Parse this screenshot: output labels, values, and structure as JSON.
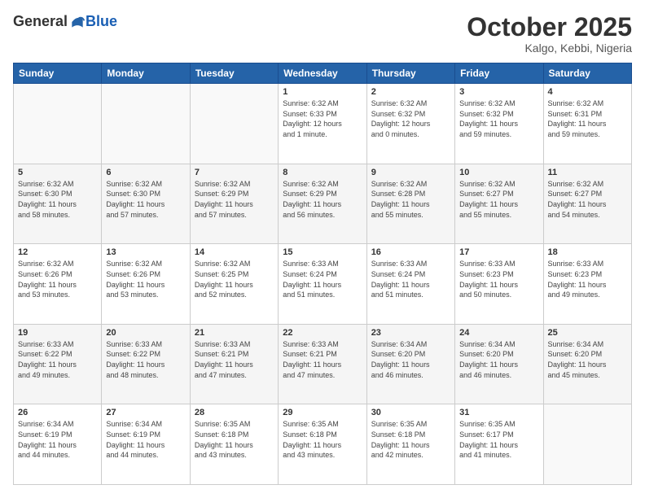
{
  "logo": {
    "general": "General",
    "blue": "Blue"
  },
  "header": {
    "month": "October 2025",
    "location": "Kalgo, Kebbi, Nigeria"
  },
  "weekdays": [
    "Sunday",
    "Monday",
    "Tuesday",
    "Wednesday",
    "Thursday",
    "Friday",
    "Saturday"
  ],
  "weeks": [
    [
      {
        "day": "",
        "info": ""
      },
      {
        "day": "",
        "info": ""
      },
      {
        "day": "",
        "info": ""
      },
      {
        "day": "1",
        "info": "Sunrise: 6:32 AM\nSunset: 6:33 PM\nDaylight: 12 hours\nand 1 minute."
      },
      {
        "day": "2",
        "info": "Sunrise: 6:32 AM\nSunset: 6:32 PM\nDaylight: 12 hours\nand 0 minutes."
      },
      {
        "day": "3",
        "info": "Sunrise: 6:32 AM\nSunset: 6:32 PM\nDaylight: 11 hours\nand 59 minutes."
      },
      {
        "day": "4",
        "info": "Sunrise: 6:32 AM\nSunset: 6:31 PM\nDaylight: 11 hours\nand 59 minutes."
      }
    ],
    [
      {
        "day": "5",
        "info": "Sunrise: 6:32 AM\nSunset: 6:30 PM\nDaylight: 11 hours\nand 58 minutes."
      },
      {
        "day": "6",
        "info": "Sunrise: 6:32 AM\nSunset: 6:30 PM\nDaylight: 11 hours\nand 57 minutes."
      },
      {
        "day": "7",
        "info": "Sunrise: 6:32 AM\nSunset: 6:29 PM\nDaylight: 11 hours\nand 57 minutes."
      },
      {
        "day": "8",
        "info": "Sunrise: 6:32 AM\nSunset: 6:29 PM\nDaylight: 11 hours\nand 56 minutes."
      },
      {
        "day": "9",
        "info": "Sunrise: 6:32 AM\nSunset: 6:28 PM\nDaylight: 11 hours\nand 55 minutes."
      },
      {
        "day": "10",
        "info": "Sunrise: 6:32 AM\nSunset: 6:27 PM\nDaylight: 11 hours\nand 55 minutes."
      },
      {
        "day": "11",
        "info": "Sunrise: 6:32 AM\nSunset: 6:27 PM\nDaylight: 11 hours\nand 54 minutes."
      }
    ],
    [
      {
        "day": "12",
        "info": "Sunrise: 6:32 AM\nSunset: 6:26 PM\nDaylight: 11 hours\nand 53 minutes."
      },
      {
        "day": "13",
        "info": "Sunrise: 6:32 AM\nSunset: 6:26 PM\nDaylight: 11 hours\nand 53 minutes."
      },
      {
        "day": "14",
        "info": "Sunrise: 6:32 AM\nSunset: 6:25 PM\nDaylight: 11 hours\nand 52 minutes."
      },
      {
        "day": "15",
        "info": "Sunrise: 6:33 AM\nSunset: 6:24 PM\nDaylight: 11 hours\nand 51 minutes."
      },
      {
        "day": "16",
        "info": "Sunrise: 6:33 AM\nSunset: 6:24 PM\nDaylight: 11 hours\nand 51 minutes."
      },
      {
        "day": "17",
        "info": "Sunrise: 6:33 AM\nSunset: 6:23 PM\nDaylight: 11 hours\nand 50 minutes."
      },
      {
        "day": "18",
        "info": "Sunrise: 6:33 AM\nSunset: 6:23 PM\nDaylight: 11 hours\nand 49 minutes."
      }
    ],
    [
      {
        "day": "19",
        "info": "Sunrise: 6:33 AM\nSunset: 6:22 PM\nDaylight: 11 hours\nand 49 minutes."
      },
      {
        "day": "20",
        "info": "Sunrise: 6:33 AM\nSunset: 6:22 PM\nDaylight: 11 hours\nand 48 minutes."
      },
      {
        "day": "21",
        "info": "Sunrise: 6:33 AM\nSunset: 6:21 PM\nDaylight: 11 hours\nand 47 minutes."
      },
      {
        "day": "22",
        "info": "Sunrise: 6:33 AM\nSunset: 6:21 PM\nDaylight: 11 hours\nand 47 minutes."
      },
      {
        "day": "23",
        "info": "Sunrise: 6:34 AM\nSunset: 6:20 PM\nDaylight: 11 hours\nand 46 minutes."
      },
      {
        "day": "24",
        "info": "Sunrise: 6:34 AM\nSunset: 6:20 PM\nDaylight: 11 hours\nand 46 minutes."
      },
      {
        "day": "25",
        "info": "Sunrise: 6:34 AM\nSunset: 6:20 PM\nDaylight: 11 hours\nand 45 minutes."
      }
    ],
    [
      {
        "day": "26",
        "info": "Sunrise: 6:34 AM\nSunset: 6:19 PM\nDaylight: 11 hours\nand 44 minutes."
      },
      {
        "day": "27",
        "info": "Sunrise: 6:34 AM\nSunset: 6:19 PM\nDaylight: 11 hours\nand 44 minutes."
      },
      {
        "day": "28",
        "info": "Sunrise: 6:35 AM\nSunset: 6:18 PM\nDaylight: 11 hours\nand 43 minutes."
      },
      {
        "day": "29",
        "info": "Sunrise: 6:35 AM\nSunset: 6:18 PM\nDaylight: 11 hours\nand 43 minutes."
      },
      {
        "day": "30",
        "info": "Sunrise: 6:35 AM\nSunset: 6:18 PM\nDaylight: 11 hours\nand 42 minutes."
      },
      {
        "day": "31",
        "info": "Sunrise: 6:35 AM\nSunset: 6:17 PM\nDaylight: 11 hours\nand 41 minutes."
      },
      {
        "day": "",
        "info": ""
      }
    ]
  ]
}
